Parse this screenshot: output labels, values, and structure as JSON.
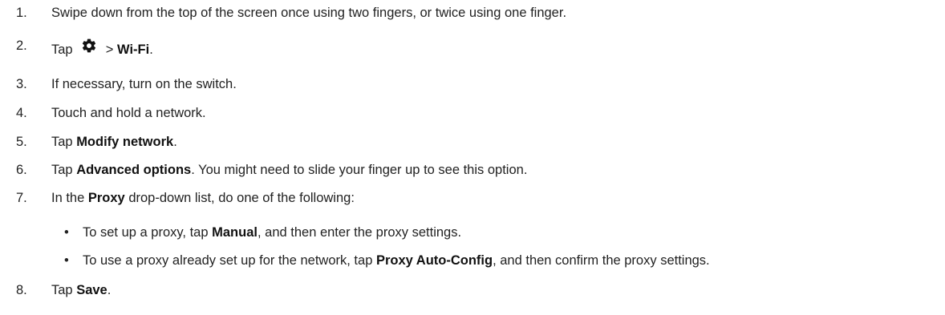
{
  "steps": [
    {
      "num": "1.",
      "parts": [
        {
          "t": "Swipe down from the top of the screen once using two fingers, or twice using one finger.",
          "b": false
        }
      ]
    },
    {
      "num": "2.",
      "pre": "Tap ",
      "icon": "gear-icon",
      "post_sep": " > ",
      "bold": "Wi-Fi",
      "post": "."
    },
    {
      "num": "3.",
      "parts": [
        {
          "t": "If necessary, turn on the switch.",
          "b": false
        }
      ]
    },
    {
      "num": "4.",
      "parts": [
        {
          "t": "Touch and hold a network.",
          "b": false
        }
      ]
    },
    {
      "num": "5.",
      "parts": [
        {
          "t": "Tap ",
          "b": false
        },
        {
          "t": "Modify network",
          "b": true
        },
        {
          "t": ".",
          "b": false
        }
      ]
    },
    {
      "num": "6.",
      "parts": [
        {
          "t": "Tap ",
          "b": false
        },
        {
          "t": "Advanced options",
          "b": true
        },
        {
          "t": ". You might need to slide your finger up to see this option.",
          "b": false
        }
      ]
    },
    {
      "num": "7.",
      "parts": [
        {
          "t": "In the ",
          "b": false
        },
        {
          "t": "Proxy",
          "b": true
        },
        {
          "t": " drop-down list, do one of the following:",
          "b": false
        }
      ]
    },
    {
      "num": "8.",
      "parts": [
        {
          "t": "Tap ",
          "b": false
        },
        {
          "t": "Save",
          "b": true
        },
        {
          "t": ".",
          "b": false
        }
      ]
    }
  ],
  "sub_items": [
    {
      "bullet": "•",
      "parts": [
        {
          "t": "To set up a proxy, tap ",
          "b": false
        },
        {
          "t": "Manual",
          "b": true
        },
        {
          "t": ", and then enter the proxy settings.",
          "b": false
        }
      ]
    },
    {
      "bullet": "•",
      "parts": [
        {
          "t": "To use a proxy already set up for the network, tap ",
          "b": false
        },
        {
          "t": "Proxy Auto-Config",
          "b": true
        },
        {
          "t": ", and then confirm the proxy settings.",
          "b": false
        }
      ]
    }
  ]
}
